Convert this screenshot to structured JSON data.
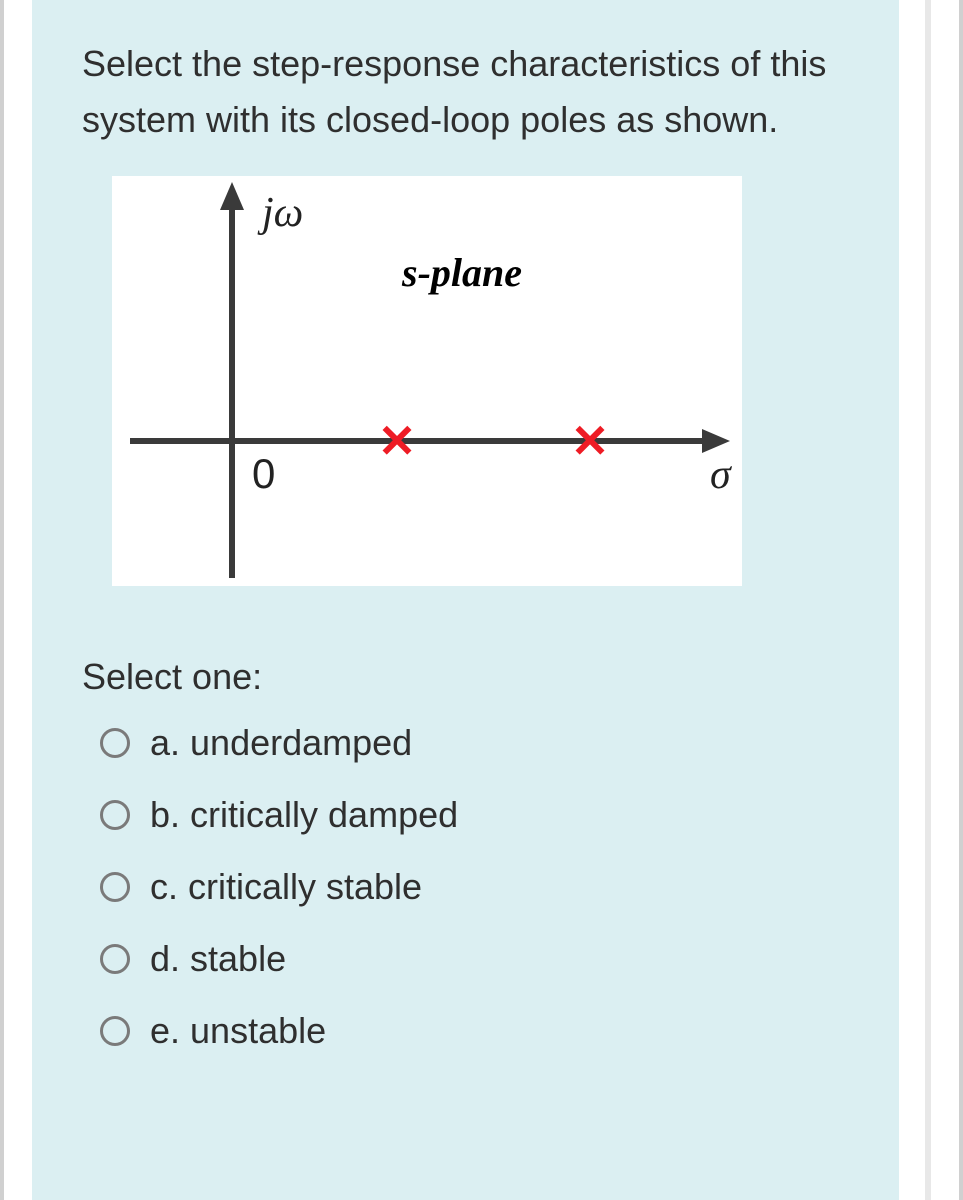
{
  "question": "Select the step-response characteristics of this system with its closed-loop poles as shown.",
  "select_prompt": "Select one:",
  "diagram": {
    "y_axis_label": "jω",
    "x_axis_label": "σ",
    "plane_label": "s-plane",
    "origin_label": "0",
    "pole_glyph": "✕"
  },
  "options": [
    {
      "label": "a. underdamped"
    },
    {
      "label": "b. critically damped"
    },
    {
      "label": "c. critically stable"
    },
    {
      "label": "d. stable"
    },
    {
      "label": "e. unstable"
    }
  ],
  "chart_data": {
    "type": "scatter",
    "title": "s-plane",
    "xlabel": "σ",
    "ylabel": "jω",
    "series": [
      {
        "name": "closed-loop poles",
        "marker": "x",
        "color": "#ee1c25",
        "x": [
          1,
          2
        ],
        "y": [
          0,
          0
        ]
      }
    ],
    "xlim": [
      -0.5,
      3
    ],
    "ylim": [
      -1,
      1.5
    ],
    "notes": "Two real poles on the positive σ axis (right-half plane), indicating an unstable step response."
  }
}
